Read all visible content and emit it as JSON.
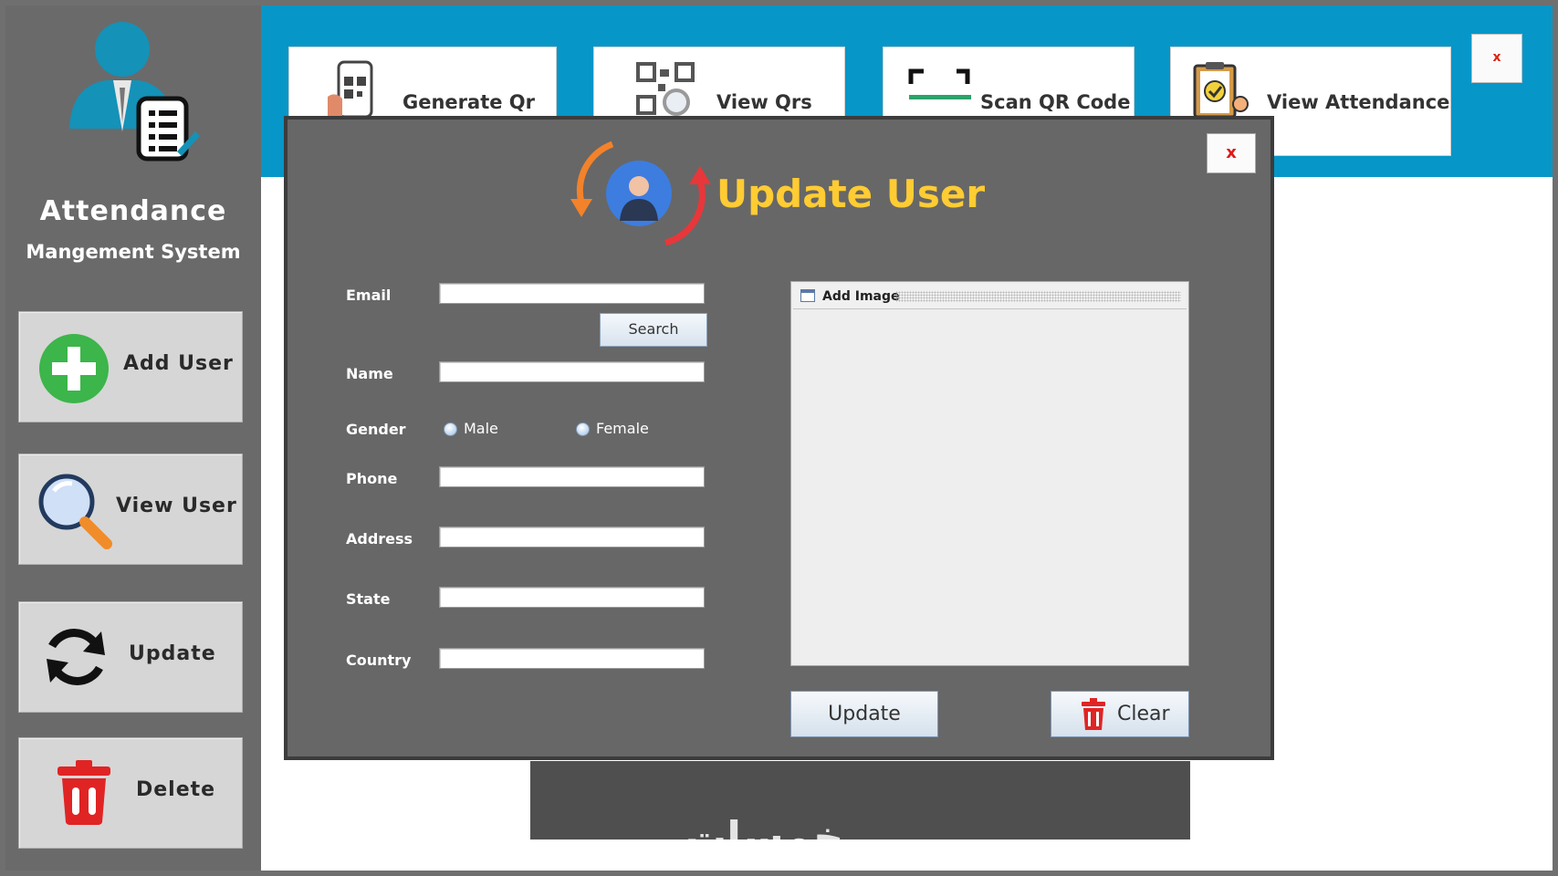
{
  "app": {
    "title": "Attendance",
    "subtitle": "Mangement System",
    "close_label": "x"
  },
  "sidebar": {
    "items": [
      {
        "label": "Add User",
        "icon": "plus-circle-icon",
        "color": "#3cb54a"
      },
      {
        "label": "View User",
        "icon": "magnifier-icon"
      },
      {
        "label": "Update",
        "icon": "refresh-icon"
      },
      {
        "label": "Delete",
        "icon": "trash-icon",
        "color": "#e02424"
      }
    ]
  },
  "toolbar": {
    "items": [
      {
        "label": "Generate Qr",
        "icon": "phone-qr-icon"
      },
      {
        "label": "View Qrs",
        "icon": "qr-search-icon"
      },
      {
        "label": "Scan QR Code",
        "icon": "scan-frame-icon"
      },
      {
        "label": "View Attendance",
        "icon": "clipboard-check-icon"
      }
    ],
    "color": "#0696c8"
  },
  "dialog": {
    "title": "Update User",
    "title_color": "#ffcc33",
    "close_label": "x",
    "fields": {
      "email": {
        "label": "Email",
        "value": ""
      },
      "name": {
        "label": "Name",
        "value": ""
      },
      "gender": {
        "label": "Gender",
        "options": [
          "Male",
          "Female"
        ],
        "selected": null
      },
      "phone": {
        "label": "Phone",
        "value": ""
      },
      "address": {
        "label": "Address",
        "value": ""
      },
      "state": {
        "label": "State",
        "value": ""
      },
      "country": {
        "label": "Country",
        "value": ""
      }
    },
    "search_label": "Search",
    "image_panel": {
      "title": "Add Image"
    },
    "update_label": "Update",
    "clear_label": "Clear"
  },
  "watermark": "خمسات"
}
